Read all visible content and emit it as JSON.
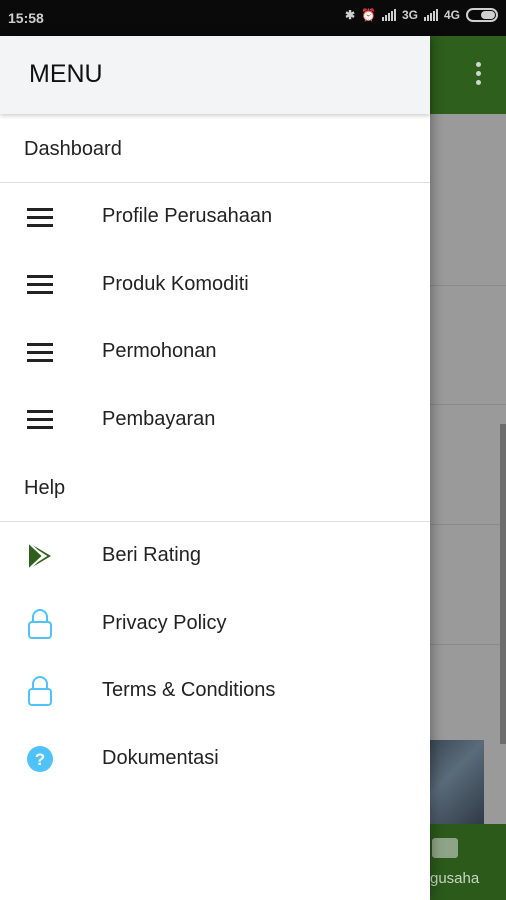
{
  "status_bar": {
    "time": "15:58",
    "network_1": "3G",
    "network_2": "4G"
  },
  "drawer": {
    "title": "MENU",
    "sections": [
      {
        "label": "Dashboard"
      },
      {
        "label": "Help"
      }
    ],
    "dashboard_items": [
      {
        "label": "Profile Perusahaan",
        "icon": "menu-icon"
      },
      {
        "label": "Produk Komoditi",
        "icon": "menu-icon"
      },
      {
        "label": "Permohonan",
        "icon": "menu-icon"
      },
      {
        "label": "Pembayaran",
        "icon": "menu-icon"
      }
    ],
    "help_items": [
      {
        "label": "Beri Rating",
        "icon": "play-store-icon"
      },
      {
        "label": "Privacy Policy",
        "icon": "lock-icon"
      },
      {
        "label": "Terms & Conditions",
        "icon": "lock-icon"
      },
      {
        "label": "Dokumentasi",
        "icon": "help-icon"
      }
    ]
  },
  "background": {
    "bottom_nav_label": "gusaha"
  },
  "colors": {
    "app_bar": "#2e5f1c",
    "accent_blue": "#4fc3f7",
    "play_green": "#2e5f1c"
  }
}
